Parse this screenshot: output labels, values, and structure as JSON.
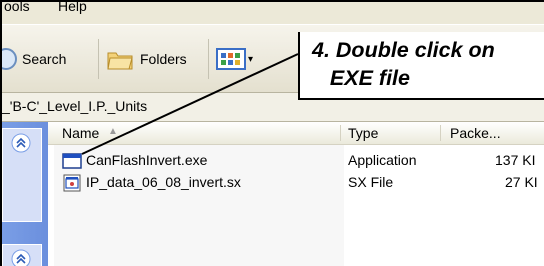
{
  "menu": {
    "items": [
      "ools",
      "Help"
    ]
  },
  "toolbar": {
    "search_label": "Search",
    "folders_label": "Folders"
  },
  "address": {
    "path": "_'B-C'_Level_I.P._Units"
  },
  "file_list": {
    "columns": [
      "Name",
      "Type",
      "Packe..."
    ],
    "rows": [
      {
        "name": "CanFlashInvert.exe",
        "type": "Application",
        "size": "137 KI",
        "icon": "application-icon"
      },
      {
        "name": "IP_data_06_08_invert.sx",
        "type": "SX File",
        "size": "27 KI",
        "icon": "sx-file-icon"
      }
    ]
  },
  "callout": {
    "text": "4. Double click on\n   EXE file"
  }
}
